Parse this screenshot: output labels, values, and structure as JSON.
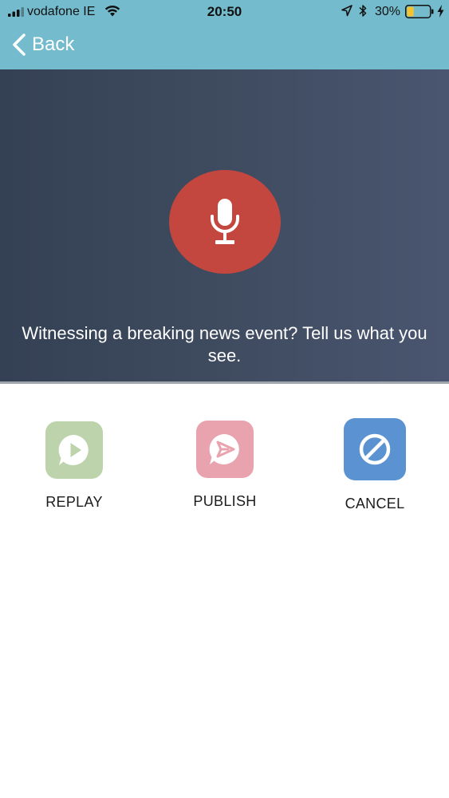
{
  "status_bar": {
    "carrier": "vodafone IE",
    "time": "20:50",
    "battery_percent": "30%",
    "battery_level": 0.3,
    "icons": [
      "signal-icon",
      "wifi-icon",
      "location-icon",
      "bluetooth-icon",
      "battery-icon",
      "charging-icon"
    ]
  },
  "nav": {
    "back_label": "Back",
    "back_icon": "chevron-left-icon",
    "bar_color": "#74bccd"
  },
  "recorder": {
    "mic_icon": "microphone-icon",
    "mic_color": "#c4473f",
    "prompt": "Witnessing a breaking news event? Tell us what you see."
  },
  "actions": [
    {
      "id": "replay",
      "label": "REPLAY",
      "icon": "replay-icon",
      "color": "#bdd3ac"
    },
    {
      "id": "publish",
      "label": "PUBLISH",
      "icon": "publish-icon",
      "color": "#e8a3ae"
    },
    {
      "id": "cancel",
      "label": "CANCEL",
      "icon": "cancel-icon",
      "color": "#5b92d1"
    }
  ]
}
